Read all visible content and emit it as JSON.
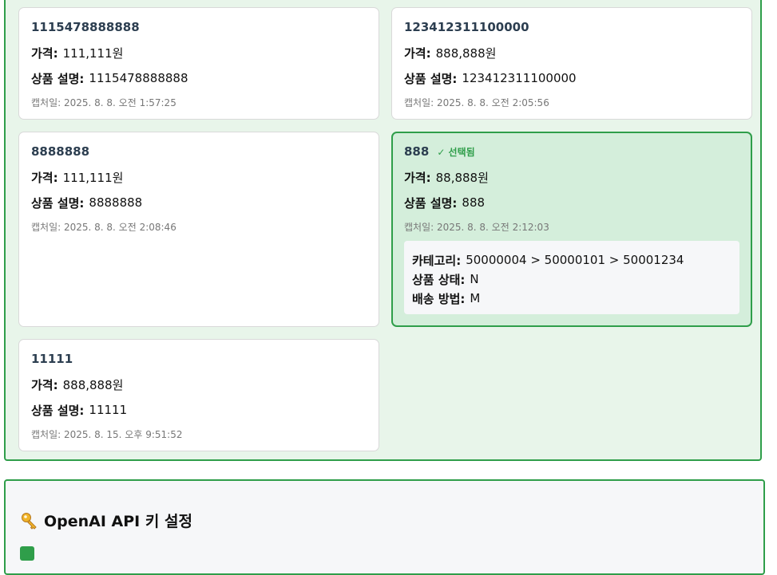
{
  "products": [
    {
      "title": "1115478888888",
      "price_label": "가격:",
      "price": "111,111원",
      "desc_label": "상품 설명:",
      "desc": "1115478888888",
      "captured": "캡처일: 2025. 8. 8. 오전 1:57:25"
    },
    {
      "title": "123412311100000",
      "price_label": "가격:",
      "price": "888,888원",
      "desc_label": "상품 설명:",
      "desc": "123412311100000",
      "captured": "캡처일: 2025. 8. 8. 오전 2:05:56"
    },
    {
      "title": "8888888",
      "price_label": "가격:",
      "price": "111,111원",
      "desc_label": "상품 설명:",
      "desc": "8888888",
      "captured": "캡처일: 2025. 8. 8. 오전 2:08:46"
    },
    {
      "title": "888",
      "selected_badge": "✓ 선택됨",
      "price_label": "가격:",
      "price": "88,888원",
      "desc_label": "상품 설명:",
      "desc": "888",
      "captured": "캡처일: 2025. 8. 8. 오전 2:12:03",
      "details": {
        "category_label": "카테고리:",
        "category": "50000004 > 50000101 > 50001234",
        "status_label": "상품 상태:",
        "status": "N",
        "shipping_label": "배송 방법:",
        "shipping": "M"
      }
    },
    {
      "title": "11111",
      "price_label": "가격:",
      "price": "888,888원",
      "desc_label": "상품 설명:",
      "desc": "11111",
      "captured": "캡처일: 2025. 8. 15. 오후 9:51:52"
    }
  ],
  "api_section": {
    "title": "OpenAI API 키 설정",
    "icon": "key-icon"
  },
  "colors": {
    "accent": "#2f9e4a",
    "selected_bg": "#d4eedb",
    "panel_bg": "#e8f5ea"
  }
}
